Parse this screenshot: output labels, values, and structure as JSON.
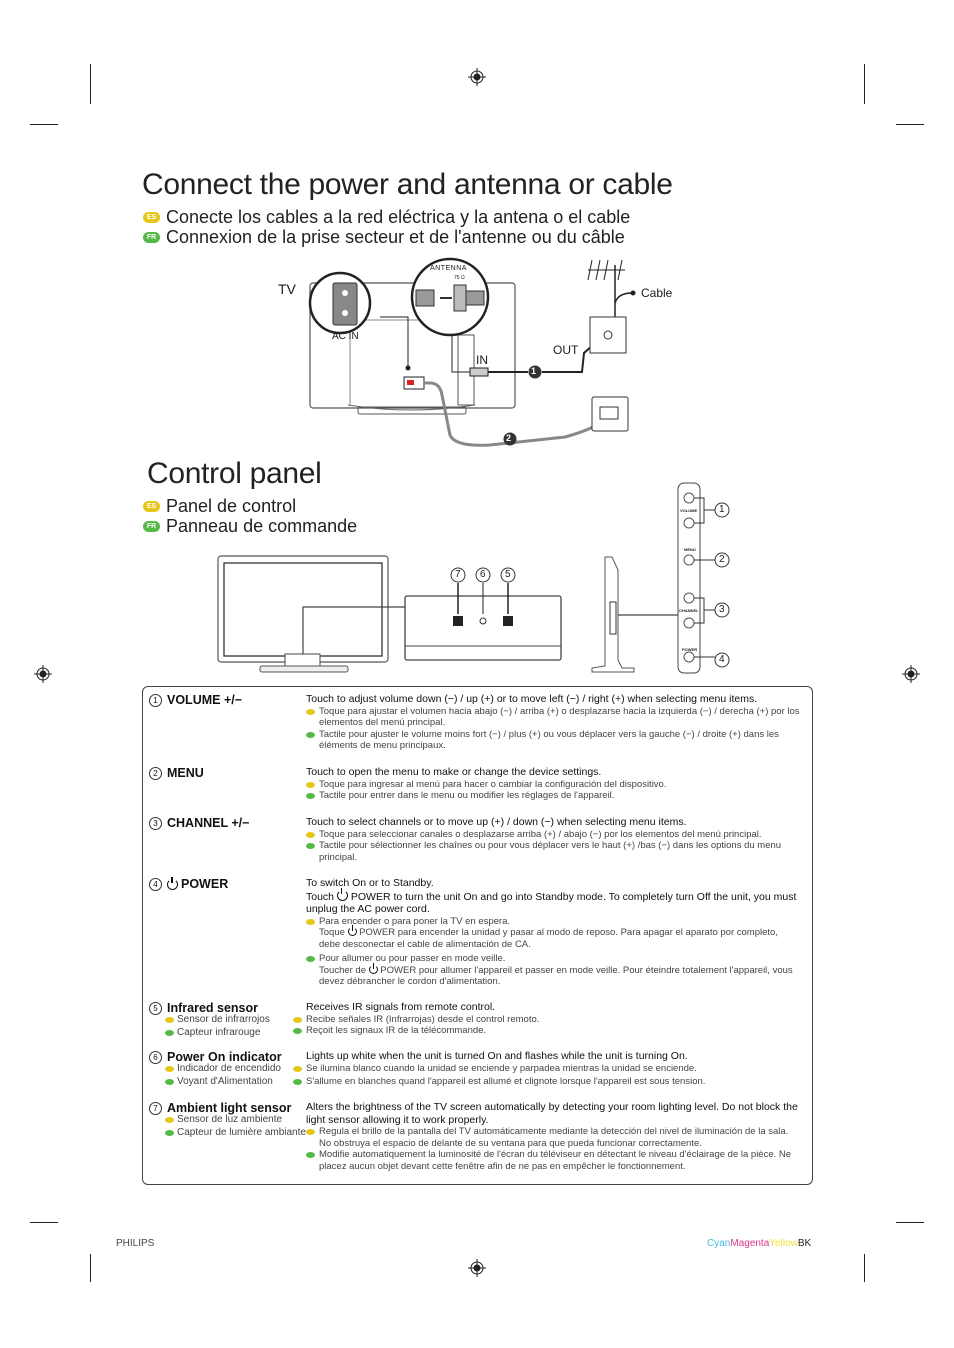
{
  "section1": {
    "title": "Connect the power and antenna or cable",
    "es_badge": "ES",
    "fr_badge": "FR",
    "es_title": "Conecte los cables a la red eléctrica y la antena o el cable",
    "fr_title": "Connexion de la prise secteur et de l'antenne ou du câble",
    "diagram": {
      "tv_label": "TV",
      "ac_in_label": "AC IN",
      "antenna_label": "ANTENNA",
      "impedance_label": "75 Ω",
      "in_label": "IN",
      "out_label": "OUT",
      "cable_label": "Cable",
      "step1": "1",
      "step2": "2"
    }
  },
  "section2": {
    "title": "Control panel",
    "es_badge": "ES",
    "fr_badge": "FR",
    "es_title": "Panel de control",
    "fr_title": "Panneau de commande",
    "diagram": {
      "front_callouts": [
        "7",
        "6",
        "5"
      ],
      "side_callouts": [
        "1",
        "2",
        "3",
        "4"
      ],
      "side_labels": [
        "VOLUME",
        "MENU",
        "CHANNEL",
        "POWER"
      ]
    }
  },
  "controls": [
    {
      "num": "1",
      "label": "VOLUME +/−",
      "en": "Touch to adjust volume down (−) / up (+) or to move left (−) / right (+) when selecting menu items.",
      "es": "Toque para ajustar el volumen hacia abajo (−) / arriba (+) o desplazarse hacia la izquierda (−) / derecha (+) por los elementos del menú principal.",
      "fr": "Tactile pour ajuster le volume moins fort (−) / plus (+) ou vous déplacer vers la gauche (−) / droite  (+) dans les éléments de menu principaux."
    },
    {
      "num": "2",
      "label": "MENU",
      "en": "Touch to open the menu to make or change the device settings.",
      "es": "Toque para ingresar al menú para hacer o cambiar la configuración del dispositivo.",
      "fr": "Tactile pour entrer dans le menu ou modifier les réglages de l'appareil."
    },
    {
      "num": "3",
      "label": "CHANNEL +/−",
      "en": "Touch to select channels or to move up (+) / down (−) when selecting menu items.",
      "es": "Toque para seleccionar canales o desplazarse arriba (+) / abajo (−) por los elementos del menú principal.",
      "fr": "Tactile pour sélectionner les chaînes ou pour vous déplacer vers le haut (+) /bas (−) dans les options du menu principal."
    },
    {
      "num": "4",
      "label": "POWER",
      "en_line1": "To switch On or to Standby.",
      "en_line2_pre": "Touch",
      "en_line2": "POWER to turn the unit On and go into Standby mode. To completely turn Off the unit, you must unplug the AC power cord.",
      "es_line1": "Para encender o para poner la TV en espera.",
      "es_line2_pre": "Toque",
      "es_line2": "POWER para encender la unidad y pasar al modo de reposo. Para apagar el aparato por completo, debe desconectar el cable de alimentación de CA.",
      "fr_line1": "Pour allumer ou pour passer en mode veille.",
      "fr_line2_pre": "Toucher de",
      "fr_line2": "POWER pour allumer l'appareil et passer en mode veille. Pour éteindre totalement l'appareil, vous devez débrancher le cordon d'alimentation."
    },
    {
      "num": "5",
      "label": "Infrared sensor",
      "label_es": "Sensor de infrarrojos",
      "label_fr": "Capteur infrarouge",
      "en": "Receives IR signals from remote control.",
      "es": "Recibe señales IR (Infrarrojas) desde el control remoto.",
      "fr": "Reçoit les signaux IR de la télécommande."
    },
    {
      "num": "6",
      "label": "Power On indicator",
      "label_es": "Indicador de encendido",
      "label_fr": "Voyant d'Alimentation",
      "en": "Lights up white when the unit is turned On and flashes while the unit is turning On.",
      "es": "Se ilumina blanco cuando la unidad se enciende y parpadea mientras la unidad se enciende.",
      "fr": "S'allume en blanches quand l'appareil est allumé et clignote lorsque l'appareil est sous tension."
    },
    {
      "num": "7",
      "label": "Ambient light sensor",
      "label_es": "Sensor de luz ambiente",
      "label_fr": "Capteur de lumière ambiante",
      "en": "Alters the brightness of the TV screen automatically by detecting your room lighting level. Do not block the light sensor allowing it to work properly.",
      "es": "Regula el brillo de la pantalla del TV automáticamente mediante la detección del nivel de iluminación de la sala. No obstruya el espacio de delante de su ventana para que pueda funcionar correctamente.",
      "fr": "Modifie automatiquement la luminosité de l'écran du téléviseur en détectant le niveau d'éclairage de la pièce. Ne placez aucun objet devant cette fenêtre afin de ne pas en empêcher le fonctionnement."
    }
  ],
  "footer": {
    "brand": "PHILIPS",
    "cyan": "Cyan",
    "magenta": "Magenta",
    "yellow": "Yellow",
    "black": "BK"
  },
  "colors": {
    "es_badge": "#e6c619",
    "fr_badge": "#55b947",
    "cyan": "#3fb6e6",
    "magenta": "#e0338f",
    "yellow": "#f2e03a"
  }
}
